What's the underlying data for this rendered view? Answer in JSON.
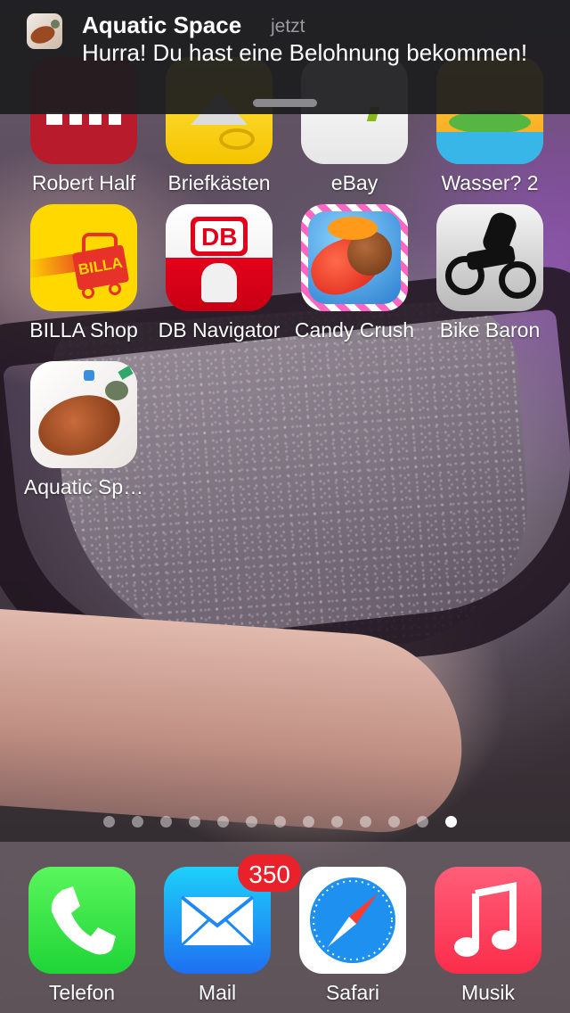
{
  "notification": {
    "app": "Aquatic Space",
    "time": "jetzt",
    "message": "Hurra! Du hast eine Belohnung bekommen!"
  },
  "apps": [
    {
      "label": "Robert Half",
      "icon": "robert-half-icon"
    },
    {
      "label": "Briefkästen",
      "icon": "mailbox-icon"
    },
    {
      "label": "eBay",
      "icon": "ebay-icon"
    },
    {
      "label": "Wasser? 2",
      "icon": "swampy-icon"
    },
    {
      "label": "BILLA Shop",
      "icon": "billa-icon"
    },
    {
      "label": "DB Navigator",
      "icon": "db-icon"
    },
    {
      "label": "Candy Crush",
      "icon": "candy-icon"
    },
    {
      "label": "Bike Baron",
      "icon": "bike-icon"
    },
    {
      "label": "Aquatic Sp…",
      "icon": "turtle-icon"
    }
  ],
  "billa_text": "BILLA",
  "db_text": "DB",
  "page_dots": {
    "count": 13,
    "active": 13
  },
  "dock": [
    {
      "label": "Telefon",
      "icon": "phone-icon"
    },
    {
      "label": "Mail",
      "icon": "mail-icon",
      "badge": "350"
    },
    {
      "label": "Safari",
      "icon": "compass-icon"
    },
    {
      "label": "Musik",
      "icon": "music-note-icon"
    }
  ],
  "colors": {
    "badge": "#e8212a",
    "phone": "#1fd437",
    "mail": "#1e88f5",
    "music": "#fb3a56",
    "billa": "#ffd800",
    "db": "#e3001b"
  }
}
